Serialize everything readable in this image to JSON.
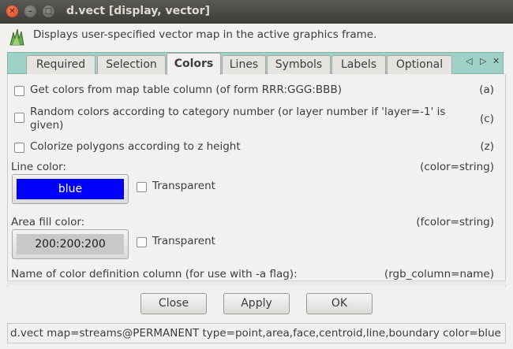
{
  "window": {
    "title": "d.vect [display, vector]",
    "controls": {
      "close": "✕",
      "minimize": "–",
      "maximize": "□"
    }
  },
  "description": "Displays user-specified vector map in the active graphics frame.",
  "tabs": [
    {
      "label": "Required",
      "active": false
    },
    {
      "label": "Selection",
      "active": false
    },
    {
      "label": "Colors",
      "active": true
    },
    {
      "label": "Lines",
      "active": false
    },
    {
      "label": "Symbols",
      "active": false
    },
    {
      "label": "Labels",
      "active": false
    },
    {
      "label": "Optional",
      "active": false
    }
  ],
  "tab_nav": {
    "left": "◁",
    "right": "▷",
    "close": "✕"
  },
  "colors_panel": {
    "options": [
      {
        "label": "Get colors from map table column (of form RRR:GGG:BBB)",
        "flag": "(a)",
        "checked": false
      },
      {
        "label_line1": "Random colors according to category number (or layer number if 'layer=-1' is",
        "label_line2": "given)",
        "flag": "(c)",
        "checked": false
      },
      {
        "label": "Colorize polygons according to z height",
        "flag": "(z)",
        "checked": false
      }
    ],
    "line_color": {
      "label": "Line color:",
      "param": "(color=string)",
      "value": "blue",
      "swatch_color": "#0000ff",
      "text_color": "#ffffff",
      "transparent_label": "Transparent",
      "transparent_checked": false
    },
    "fill_color": {
      "label": "Area fill color:",
      "param": "(fcolor=string)",
      "value": "200:200:200",
      "swatch_color": "#c8c8c8",
      "text_color": "#1e1e1e",
      "transparent_label": "Transparent",
      "transparent_checked": false
    },
    "rgb_column": {
      "label": "Name of color definition column (for use with -a flag):",
      "param": "(rgb_column=name)"
    }
  },
  "buttons": {
    "close": "Close",
    "apply": "Apply",
    "ok": "OK"
  },
  "status": "d.vect map=streams@PERMANENT type=point,area,face,centroid,line,boundary color=blue"
}
